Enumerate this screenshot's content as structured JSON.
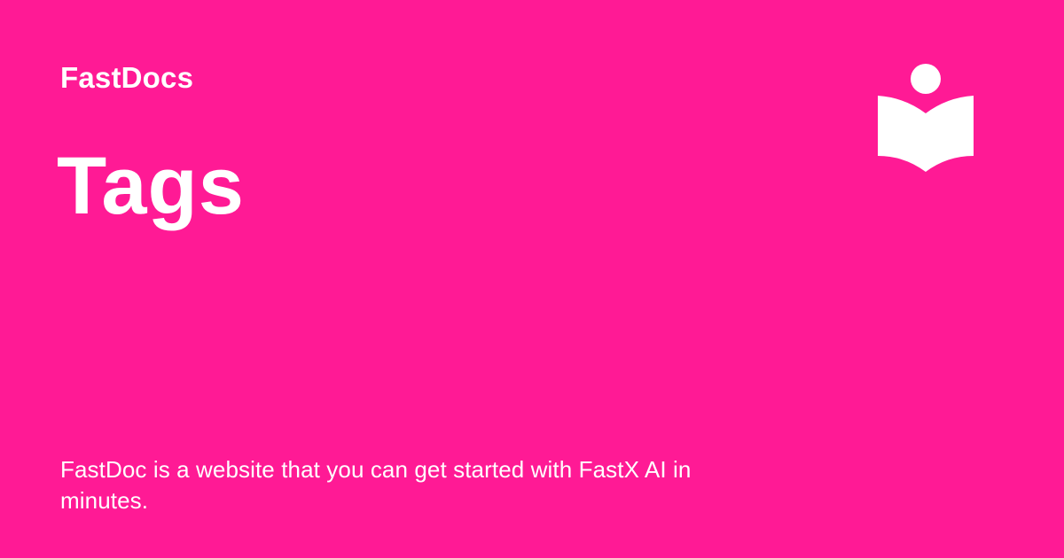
{
  "header": {
    "site_name": "FastDocs",
    "logo_icon": "reader-book-icon"
  },
  "main": {
    "page_title": "Tags",
    "description": "FastDoc is a website that you can get started with FastX AI in minutes."
  },
  "theme": {
    "background": "#FF1A95",
    "foreground": "#FFFFFF"
  }
}
